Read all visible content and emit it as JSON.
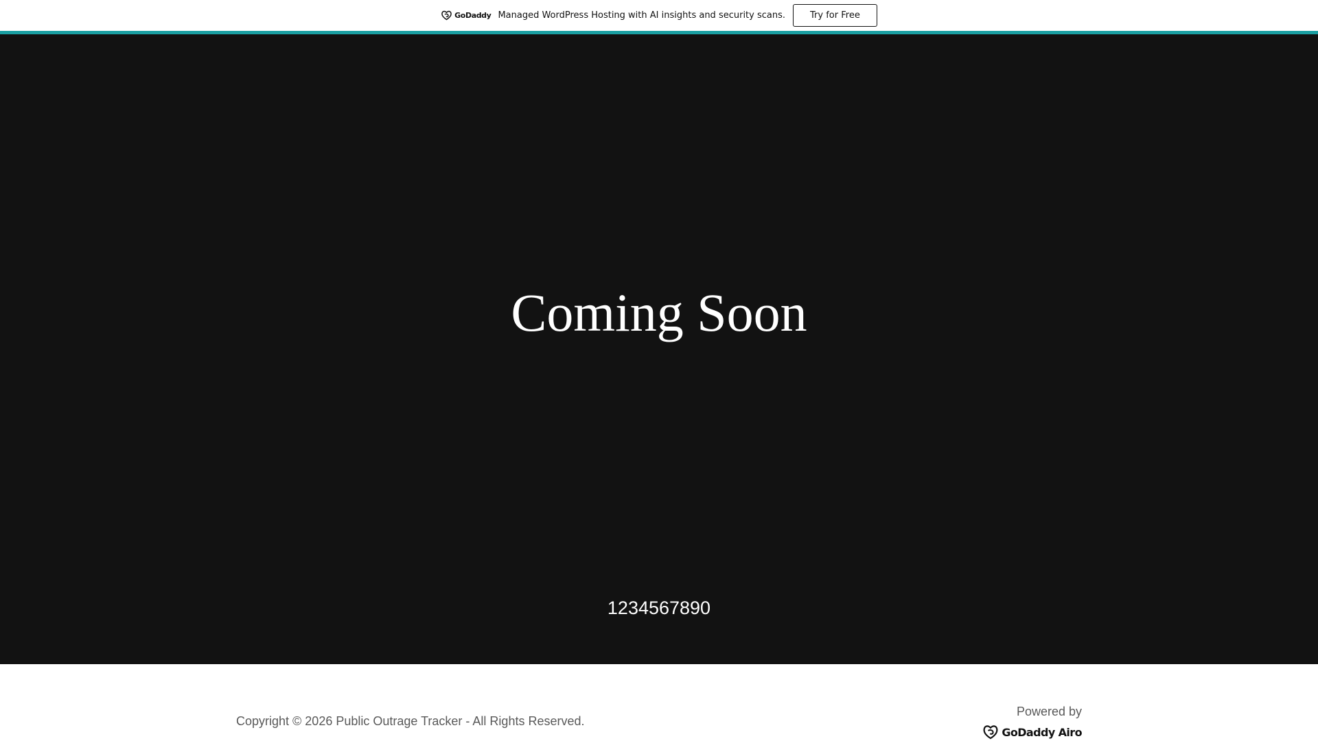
{
  "promo": {
    "brand": "GoDaddy",
    "message": "Managed WordPress Hosting with AI insights and security scans.",
    "cta_label": "Try for Free",
    "accent_color": "#1ba0a3"
  },
  "hero": {
    "title": "Coming Soon",
    "phone": "1234567890",
    "background_color": "#121212"
  },
  "footer": {
    "copyright": "Copyright © 2026 Public Outrage Tracker - All Rights Reserved.",
    "powered_by_label": "Powered by",
    "powered_by_brand": "GoDaddy Airo"
  },
  "icons": {
    "promo_logo": "godaddy-logo-icon",
    "footer_logo": "godaddy-airo-logo-icon"
  }
}
